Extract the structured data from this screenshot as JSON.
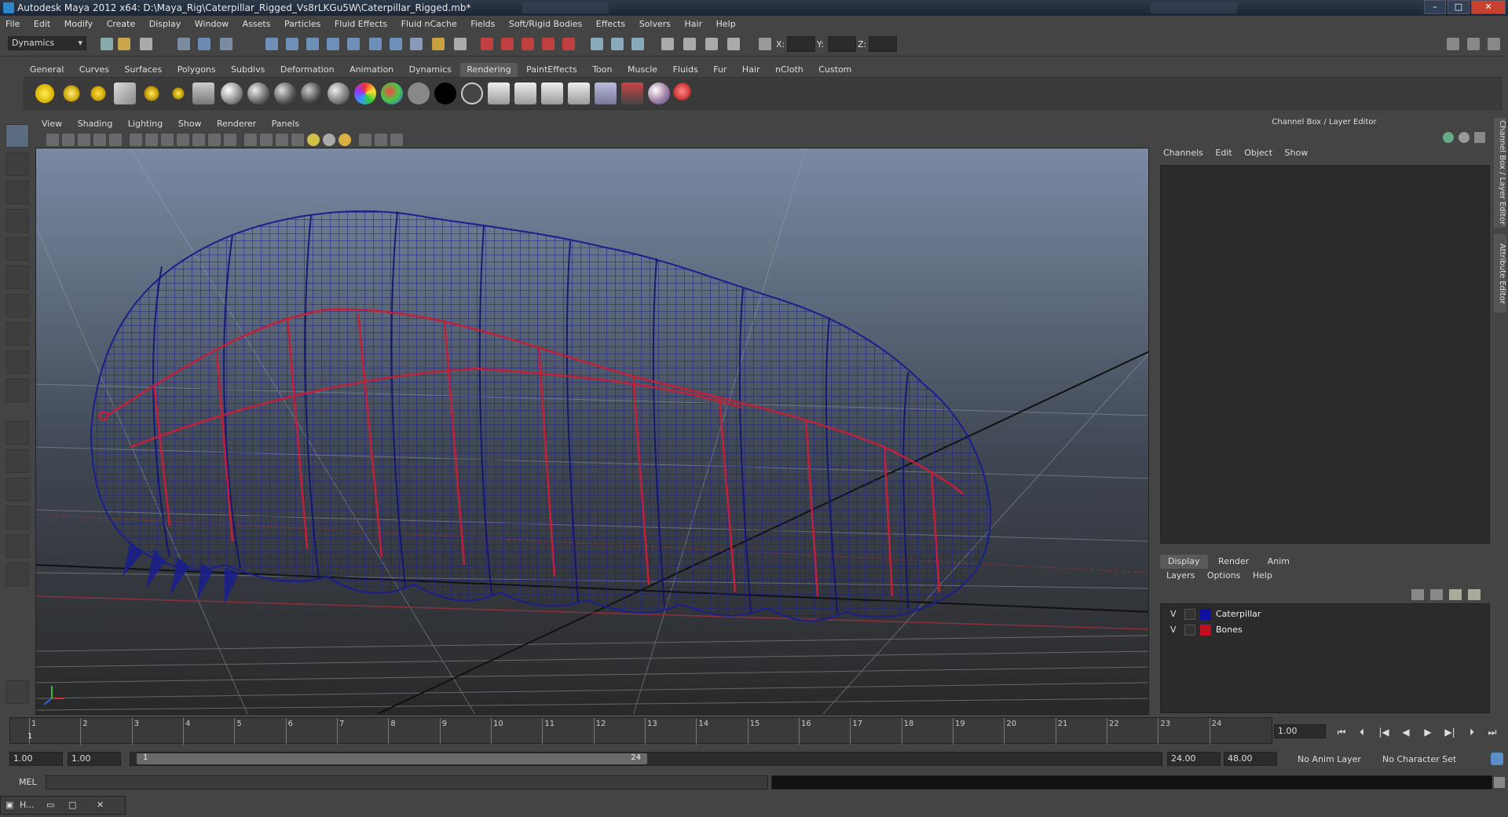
{
  "window": {
    "title": "Autodesk Maya 2012 x64: D:\\Maya_Rig\\Caterpillar_Rigged_Vs8rLKGu5W\\Caterpillar_Rigged.mb*"
  },
  "menubar": [
    "File",
    "Edit",
    "Modify",
    "Create",
    "Display",
    "Window",
    "Assets",
    "Particles",
    "Fluid Effects",
    "Fluid nCache",
    "Fields",
    "Soft/Rigid Bodies",
    "Effects",
    "Solvers",
    "Hair",
    "Help"
  ],
  "statusline": {
    "menuset": "Dynamics",
    "x_label": "X:",
    "y_label": "Y:",
    "z_label": "Z:"
  },
  "shelf": {
    "tabs": [
      "General",
      "Curves",
      "Surfaces",
      "Polygons",
      "Subdivs",
      "Deformation",
      "Animation",
      "Dynamics",
      "Rendering",
      "PaintEffects",
      "Toon",
      "Muscle",
      "Fluids",
      "Fur",
      "Hair",
      "nCloth",
      "Custom"
    ],
    "active_tab": "Rendering"
  },
  "viewport": {
    "menus": [
      "View",
      "Shading",
      "Lighting",
      "Show",
      "Renderer",
      "Panels"
    ],
    "mesh_color": "#1a1f8a",
    "bone_color": "#c0203a"
  },
  "channel_box": {
    "title": "Channel Box / Layer Editor",
    "menus": [
      "Channels",
      "Edit",
      "Object",
      "Show"
    ]
  },
  "layer_editor": {
    "tabs": [
      "Display",
      "Render",
      "Anim"
    ],
    "active_tab": "Display",
    "menus": [
      "Layers",
      "Options",
      "Help"
    ],
    "layers": [
      {
        "visible": "V",
        "name": "Caterpillar",
        "color": "#1010a0"
      },
      {
        "visible": "V",
        "name": "Bones",
        "color": "#c01020"
      }
    ]
  },
  "side_tabs": [
    "Channel Box / Layer Editor",
    "Attribute Editor"
  ],
  "timeslider": {
    "ticks": [
      "1",
      "2",
      "3",
      "4",
      "5",
      "6",
      "7",
      "8",
      "9",
      "10",
      "11",
      "12",
      "13",
      "14",
      "15",
      "16",
      "17",
      "18",
      "19",
      "20",
      "21",
      "22",
      "23",
      "24"
    ],
    "current_frame_marker": "1",
    "current_time": "1.00"
  },
  "range": {
    "start": "1.00",
    "playback_start": "1.00",
    "range_start_label": "1",
    "range_end_label": "24",
    "playback_end": "24.00",
    "end": "48.00",
    "anim_layer": "No Anim Layer",
    "character_set": "No Character Set"
  },
  "command_line": {
    "label": "MEL"
  },
  "taskbar": {
    "label": "H..."
  }
}
